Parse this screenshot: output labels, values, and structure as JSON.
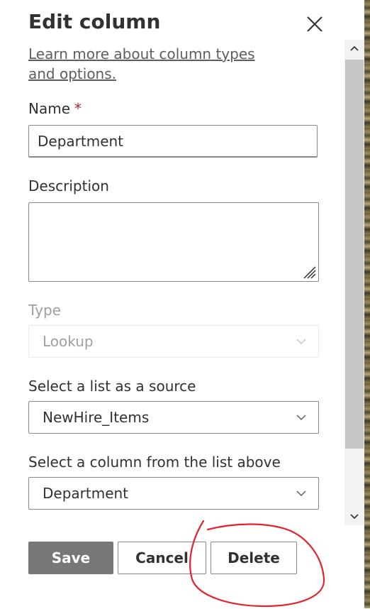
{
  "panel": {
    "title": "Edit column",
    "close_icon": "close-icon",
    "learn_more_link": "Learn more about column types and options."
  },
  "fields": {
    "name": {
      "label": "Name",
      "required_marker": "*",
      "value": "Department"
    },
    "description": {
      "label": "Description",
      "value": ""
    },
    "type": {
      "label": "Type",
      "value": "Lookup",
      "disabled": true
    },
    "source_list": {
      "label": "Select a list as a source",
      "value": "NewHire_Items"
    },
    "source_column": {
      "label": "Select a column from the list above",
      "value": "Department"
    }
  },
  "buttons": {
    "save": "Save",
    "cancel": "Cancel",
    "delete": "Delete"
  },
  "scrollbar": {
    "up_icon": "chevron-up-icon",
    "down_icon": "chevron-down-icon"
  },
  "colors": {
    "primary_disabled": "#797775",
    "required": "#a4262c",
    "annotation": "#e8202a",
    "accent": "#0078d4"
  },
  "annotation": {
    "shape": "hand-drawn circle around delete button"
  }
}
